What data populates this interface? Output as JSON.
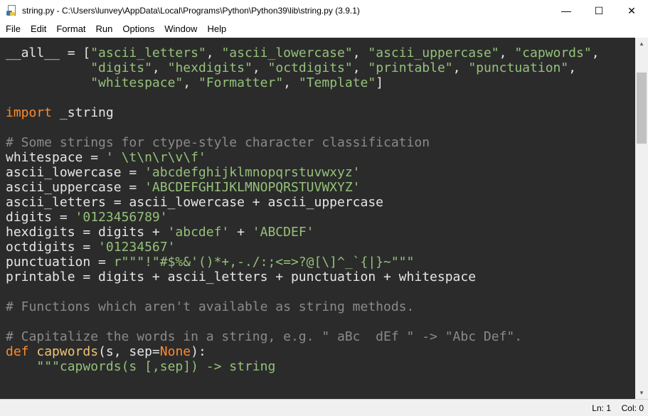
{
  "window": {
    "title": "string.py - C:\\Users\\lunvey\\AppData\\Local\\Programs\\Python\\Python39\\lib\\string.py (3.9.1)",
    "minimize": "—",
    "maximize": "☐",
    "close": "✕"
  },
  "menu": [
    "File",
    "Edit",
    "Format",
    "Run",
    "Options",
    "Window",
    "Help"
  ],
  "code_lines": [
    [
      [
        "nm",
        "__all__ = ["
      ],
      [
        "str",
        "\"ascii_letters\""
      ],
      [
        "nm",
        ", "
      ],
      [
        "str",
        "\"ascii_lowercase\""
      ],
      [
        "nm",
        ", "
      ],
      [
        "str",
        "\"ascii_uppercase\""
      ],
      [
        "nm",
        ", "
      ],
      [
        "str",
        "\"capwords\""
      ],
      [
        "nm",
        ","
      ]
    ],
    [
      [
        "nm",
        "           "
      ],
      [
        "str",
        "\"digits\""
      ],
      [
        "nm",
        ", "
      ],
      [
        "str",
        "\"hexdigits\""
      ],
      [
        "nm",
        ", "
      ],
      [
        "str",
        "\"octdigits\""
      ],
      [
        "nm",
        ", "
      ],
      [
        "str",
        "\"printable\""
      ],
      [
        "nm",
        ", "
      ],
      [
        "str",
        "\"punctuation\""
      ],
      [
        "nm",
        ","
      ]
    ],
    [
      [
        "nm",
        "           "
      ],
      [
        "str",
        "\"whitespace\""
      ],
      [
        "nm",
        ", "
      ],
      [
        "str",
        "\"Formatter\""
      ],
      [
        "nm",
        ", "
      ],
      [
        "str",
        "\"Template\""
      ],
      [
        "nm",
        "]"
      ]
    ],
    [
      [
        "nm",
        ""
      ]
    ],
    [
      [
        "kw",
        "import"
      ],
      [
        "nm",
        " _string"
      ]
    ],
    [
      [
        "nm",
        ""
      ]
    ],
    [
      [
        "cm",
        "# Some strings for ctype-style character classification"
      ]
    ],
    [
      [
        "nm",
        "whitespace = "
      ],
      [
        "str",
        "' \\t\\n\\r\\v\\f'"
      ]
    ],
    [
      [
        "nm",
        "ascii_lowercase = "
      ],
      [
        "str",
        "'abcdefghijklmnopqrstuvwxyz'"
      ]
    ],
    [
      [
        "nm",
        "ascii_uppercase = "
      ],
      [
        "str",
        "'ABCDEFGHIJKLMNOPQRSTUVWXYZ'"
      ]
    ],
    [
      [
        "nm",
        "ascii_letters = ascii_lowercase + ascii_uppercase"
      ]
    ],
    [
      [
        "nm",
        "digits = "
      ],
      [
        "str",
        "'0123456789'"
      ]
    ],
    [
      [
        "nm",
        "hexdigits = digits + "
      ],
      [
        "str",
        "'abcdef'"
      ],
      [
        "nm",
        " + "
      ],
      [
        "str",
        "'ABCDEF'"
      ]
    ],
    [
      [
        "nm",
        "octdigits = "
      ],
      [
        "str",
        "'01234567'"
      ]
    ],
    [
      [
        "nm",
        "punctuation = "
      ],
      [
        "str",
        "r\"\"\"!\"#$%&'()*+,-./:;<=>?@[\\]^_`{|}~\"\"\""
      ]
    ],
    [
      [
        "nm",
        "printable = digits + ascii_letters + punctuation + whitespace"
      ]
    ],
    [
      [
        "nm",
        ""
      ]
    ],
    [
      [
        "cm",
        "# Functions which aren't available as string methods."
      ]
    ],
    [
      [
        "nm",
        ""
      ]
    ],
    [
      [
        "cm",
        "# Capitalize the words in a string, e.g. \" aBc  dEf \" -> \"Abc Def\"."
      ]
    ],
    [
      [
        "kw",
        "def"
      ],
      [
        "nm",
        " "
      ],
      [
        "fn",
        "capwords"
      ],
      [
        "nm",
        "(s, sep="
      ],
      [
        "kw",
        "None"
      ],
      [
        "nm",
        "):"
      ]
    ],
    [
      [
        "nm",
        "    "
      ],
      [
        "str",
        "\"\"\"capwords(s [,sep]) -> string"
      ]
    ]
  ],
  "status": {
    "ln": "Ln: 1",
    "col": "Col: 0"
  }
}
